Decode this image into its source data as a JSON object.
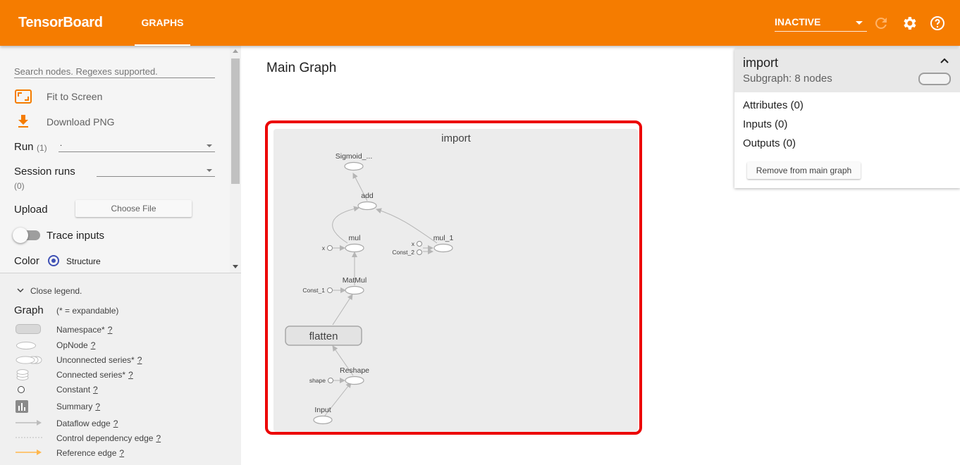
{
  "app": {
    "title": "TensorBoard"
  },
  "tabs": [
    {
      "label": "GRAPHS"
    }
  ],
  "header": {
    "run_select_value": "INACTIVE"
  },
  "sidebar": {
    "search_placeholder": "Search nodes. Regexes supported.",
    "fit_to_screen": "Fit to Screen",
    "download_png": "Download PNG",
    "run_label": "Run",
    "run_count": "(1)",
    "run_value": ".",
    "session_runs_label": "Session runs",
    "session_runs_count": "(0)",
    "upload_label": "Upload",
    "choose_file": "Choose File",
    "trace_inputs": "Trace inputs",
    "color_label": "Color",
    "color_option": "Structure"
  },
  "legend": {
    "close_label": "Close legend.",
    "graph_label": "Graph",
    "expandable_note": "(* = expandable)",
    "items": [
      {
        "label": "Namespace*",
        "help": "?"
      },
      {
        "label": "OpNode",
        "help": "?"
      },
      {
        "label": "Unconnected series*",
        "help": "?"
      },
      {
        "label": "Connected series*",
        "help": "?"
      },
      {
        "label": "Constant",
        "help": "?"
      },
      {
        "label": "Summary",
        "help": "?"
      },
      {
        "label": "Dataflow edge",
        "help": "?"
      },
      {
        "label": "Control dependency edge",
        "help": "?"
      },
      {
        "label": "Reference edge",
        "help": "?"
      }
    ]
  },
  "main": {
    "title": "Main Graph"
  },
  "graph": {
    "namespace": "import",
    "nodes": {
      "sigmoid": "Sigmoid_...",
      "add": "add",
      "mul": "mul",
      "mul_1": "mul_1",
      "x": "x",
      "x2": "x",
      "const_2": "Const_2",
      "matmul": "MatMul",
      "const_1": "Const_1",
      "flatten": "flatten",
      "reshape": "Reshape",
      "shape": "shape",
      "input": "Input"
    }
  },
  "info_card": {
    "title": "import",
    "subtitle": "Subgraph: 8 nodes",
    "attributes": "Attributes (0)",
    "inputs": "Inputs (0)",
    "outputs": "Outputs (0)",
    "remove_button": "Remove from main graph"
  },
  "colors": {
    "accent": "#f57c00",
    "selection": "#ec0000",
    "radio": "#3f51b5"
  }
}
